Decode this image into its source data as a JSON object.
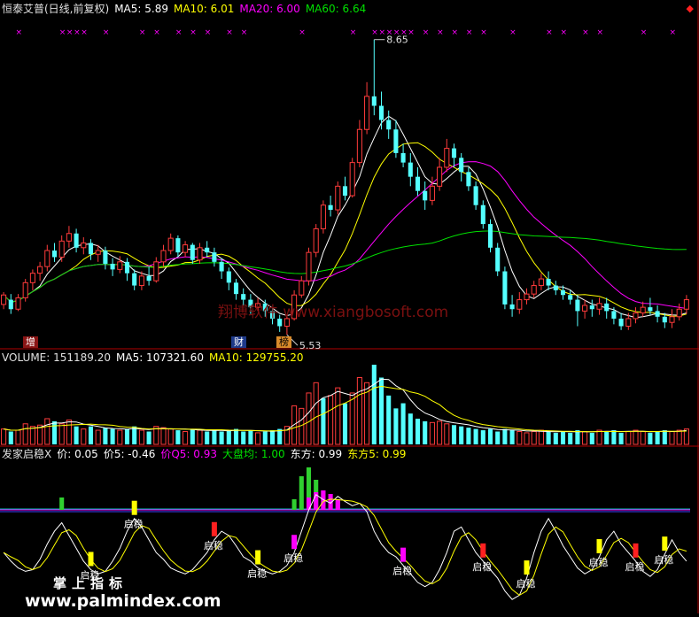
{
  "price_header": {
    "title": "恒泰艾普(日线,前复权)",
    "ma5": "MA5: 5.89",
    "ma10": "MA10: 6.01",
    "ma20": "MA20: 6.00",
    "ma60": "MA60: 6.64"
  },
  "volume_header": {
    "volume": "VOLUME: 151189.20",
    "ma5": "MA5: 107321.60",
    "ma10": "MA10: 129755.20"
  },
  "indicator_header": {
    "name": "发家启稳X",
    "jia": "价: 0.05",
    "jia5": "价5: -0.46",
    "jiaq5": "价Q5: 0.93",
    "dapan": "大盘均: 1.00",
    "dongfang": "东方: 0.99",
    "dongfang5": "东方5: 0.99"
  },
  "annotations": {
    "high": "8.65",
    "low": "5.53",
    "tag_zeng": "增",
    "tag_cai": "财",
    "tag_bang": "榜"
  },
  "signal_label": "启稳",
  "watermarks": {
    "center": "翔博软件 www.xiangbosoft.com",
    "zhang": "掌上指标",
    "site": "www.palmindex.com"
  },
  "colors": {
    "up": "#ff3b3b",
    "down": "#54ffff",
    "ma5": "#ffffff",
    "ma10": "#ffff00",
    "ma20": "#ff00ff",
    "ma60": "#00e000",
    "border": "#b00000"
  },
  "chart_data": {
    "type": "candlestick",
    "high": 8.65,
    "low": 5.53,
    "ylim": [
      5.4,
      8.9
    ],
    "candles": [
      [
        5.85,
        5.95,
        5.8,
        5.98
      ],
      [
        5.9,
        5.8,
        5.75,
        5.96
      ],
      [
        5.8,
        5.92,
        5.78,
        5.96
      ],
      [
        5.92,
        6.08,
        5.88,
        6.12
      ],
      [
        6.08,
        6.18,
        6.0,
        6.22
      ],
      [
        6.18,
        6.25,
        6.1,
        6.3
      ],
      [
        6.25,
        6.42,
        6.2,
        6.48
      ],
      [
        6.42,
        6.35,
        6.3,
        6.5
      ],
      [
        6.35,
        6.52,
        6.3,
        6.58
      ],
      [
        6.52,
        6.6,
        6.45,
        6.68
      ],
      [
        6.6,
        6.45,
        6.4,
        6.65
      ],
      [
        6.45,
        6.5,
        6.38,
        6.56
      ],
      [
        6.5,
        6.38,
        6.32,
        6.54
      ],
      [
        6.38,
        6.42,
        6.3,
        6.48
      ],
      [
        6.42,
        6.28,
        6.22,
        6.46
      ],
      [
        6.28,
        6.22,
        6.15,
        6.34
      ],
      [
        6.22,
        6.3,
        6.18,
        6.36
      ],
      [
        6.3,
        6.18,
        6.1,
        6.34
      ],
      [
        6.18,
        6.05,
        6.0,
        6.22
      ],
      [
        6.05,
        6.15,
        6.0,
        6.2
      ],
      [
        6.15,
        6.1,
        6.05,
        6.25
      ],
      [
        6.1,
        6.3,
        6.08,
        6.35
      ],
      [
        6.3,
        6.42,
        6.25,
        6.48
      ],
      [
        6.42,
        6.55,
        6.38,
        6.6
      ],
      [
        6.55,
        6.4,
        6.35,
        6.58
      ],
      [
        6.4,
        6.48,
        6.35,
        6.52
      ],
      [
        6.48,
        6.32,
        6.28,
        6.5
      ],
      [
        6.32,
        6.45,
        6.28,
        6.5
      ],
      [
        6.45,
        6.4,
        6.35,
        6.52
      ],
      [
        6.4,
        6.3,
        6.25,
        6.45
      ],
      [
        6.3,
        6.2,
        6.12,
        6.34
      ],
      [
        6.2,
        6.08,
        6.0,
        6.24
      ],
      [
        6.08,
        5.96,
        5.9,
        6.12
      ],
      [
        5.96,
        5.9,
        5.84,
        6.02
      ],
      [
        5.9,
        5.82,
        5.75,
        5.96
      ],
      [
        5.82,
        5.86,
        5.78,
        5.92
      ],
      [
        5.86,
        5.78,
        5.72,
        5.9
      ],
      [
        5.78,
        5.7,
        5.64,
        5.82
      ],
      [
        5.7,
        5.62,
        5.56,
        5.74
      ],
      [
        5.62,
        5.7,
        5.53,
        5.74
      ],
      [
        5.7,
        5.95,
        5.68,
        6.0
      ],
      [
        5.95,
        6.1,
        5.92,
        6.15
      ],
      [
        6.1,
        6.4,
        6.05,
        6.45
      ],
      [
        6.4,
        6.65,
        6.35,
        6.7
      ],
      [
        6.65,
        6.9,
        6.6,
        6.95
      ],
      [
        6.9,
        6.85,
        6.78,
        7.0
      ],
      [
        6.85,
        7.1,
        6.8,
        7.15
      ],
      [
        7.1,
        7.0,
        6.95,
        7.2
      ],
      [
        7.0,
        7.35,
        6.98,
        7.4
      ],
      [
        7.35,
        7.7,
        7.3,
        7.8
      ],
      [
        7.7,
        8.05,
        7.65,
        8.2
      ],
      [
        8.05,
        7.95,
        7.85,
        8.65
      ],
      [
        7.95,
        7.8,
        7.7,
        8.1
      ],
      [
        7.8,
        7.7,
        7.6,
        7.9
      ],
      [
        7.7,
        7.45,
        7.4,
        7.8
      ],
      [
        7.45,
        7.35,
        7.3,
        7.55
      ],
      [
        7.35,
        7.2,
        7.1,
        7.45
      ],
      [
        7.2,
        7.05,
        7.0,
        7.3
      ],
      [
        7.05,
        6.95,
        6.85,
        7.15
      ],
      [
        6.95,
        7.1,
        6.9,
        7.2
      ],
      [
        7.1,
        7.3,
        7.05,
        7.4
      ],
      [
        7.3,
        7.5,
        7.25,
        7.6
      ],
      [
        7.5,
        7.4,
        7.3,
        7.55
      ],
      [
        7.4,
        7.25,
        7.15,
        7.45
      ],
      [
        7.25,
        7.1,
        7.05,
        7.3
      ],
      [
        7.1,
        6.9,
        6.85,
        7.15
      ],
      [
        6.9,
        6.7,
        6.65,
        6.95
      ],
      [
        6.7,
        6.45,
        6.4,
        6.75
      ],
      [
        6.45,
        6.2,
        6.15,
        6.5
      ],
      [
        6.2,
        5.85,
        5.8,
        6.25
      ],
      [
        5.85,
        5.8,
        5.72,
        5.95
      ],
      [
        5.8,
        5.9,
        5.75,
        5.98
      ],
      [
        5.9,
        5.96,
        5.85,
        6.02
      ],
      [
        5.96,
        6.05,
        5.92,
        6.1
      ],
      [
        6.05,
        6.12,
        6.0,
        6.18
      ],
      [
        6.12,
        6.05,
        6.0,
        6.2
      ],
      [
        6.05,
        6.0,
        5.95,
        6.1
      ],
      [
        6.0,
        5.95,
        5.9,
        6.05
      ],
      [
        5.95,
        5.9,
        5.85,
        6.0
      ],
      [
        5.9,
        5.78,
        5.62,
        5.95
      ],
      [
        5.78,
        5.84,
        5.7,
        5.9
      ],
      [
        5.84,
        5.8,
        5.72,
        5.9
      ],
      [
        5.8,
        5.86,
        5.74,
        5.92
      ],
      [
        5.86,
        5.78,
        5.7,
        5.92
      ],
      [
        5.78,
        5.7,
        5.64,
        5.82
      ],
      [
        5.7,
        5.62,
        5.58,
        5.76
      ],
      [
        5.62,
        5.7,
        5.58,
        5.76
      ],
      [
        5.7,
        5.76,
        5.65,
        5.82
      ],
      [
        5.76,
        5.82,
        5.72,
        5.88
      ],
      [
        5.82,
        5.78,
        5.74,
        5.92
      ],
      [
        5.78,
        5.72,
        5.66,
        5.84
      ],
      [
        5.72,
        5.66,
        5.6,
        5.76
      ],
      [
        5.66,
        5.72,
        5.6,
        5.8
      ],
      [
        5.72,
        5.8,
        5.68,
        5.86
      ],
      [
        5.8,
        5.9,
        5.75,
        5.95
      ]
    ],
    "volume": [
      [
        0.6,
        1
      ],
      [
        0.5,
        0
      ],
      [
        0.55,
        1
      ],
      [
        0.8,
        1
      ],
      [
        0.7,
        1
      ],
      [
        0.75,
        1
      ],
      [
        1.0,
        1
      ],
      [
        0.9,
        0
      ],
      [
        0.8,
        1
      ],
      [
        0.95,
        1
      ],
      [
        0.7,
        0
      ],
      [
        0.6,
        1
      ],
      [
        0.7,
        0
      ],
      [
        0.55,
        1
      ],
      [
        0.65,
        0
      ],
      [
        0.6,
        0
      ],
      [
        0.55,
        1
      ],
      [
        0.6,
        0
      ],
      [
        0.7,
        0
      ],
      [
        0.55,
        1
      ],
      [
        0.5,
        0
      ],
      [
        0.7,
        1
      ],
      [
        0.65,
        1
      ],
      [
        0.6,
        1
      ],
      [
        0.55,
        0
      ],
      [
        0.5,
        1
      ],
      [
        0.6,
        0
      ],
      [
        0.55,
        1
      ],
      [
        0.5,
        0
      ],
      [
        0.55,
        0
      ],
      [
        0.5,
        0
      ],
      [
        0.55,
        0
      ],
      [
        0.6,
        0
      ],
      [
        0.5,
        0
      ],
      [
        0.55,
        0
      ],
      [
        0.45,
        1
      ],
      [
        0.5,
        0
      ],
      [
        0.55,
        0
      ],
      [
        0.6,
        0
      ],
      [
        0.7,
        1
      ],
      [
        1.5,
        1
      ],
      [
        1.4,
        1
      ],
      [
        2.0,
        1
      ],
      [
        2.4,
        1
      ],
      [
        1.8,
        0
      ],
      [
        1.9,
        1
      ],
      [
        2.2,
        1
      ],
      [
        1.6,
        0
      ],
      [
        2.0,
        1
      ],
      [
        2.6,
        1
      ],
      [
        2.4,
        1
      ],
      [
        3.1,
        0
      ],
      [
        2.6,
        0
      ],
      [
        1.9,
        0
      ],
      [
        1.4,
        0
      ],
      [
        1.6,
        0
      ],
      [
        1.2,
        0
      ],
      [
        1.0,
        0
      ],
      [
        0.9,
        0
      ],
      [
        0.85,
        1
      ],
      [
        0.9,
        1
      ],
      [
        0.8,
        1
      ],
      [
        0.75,
        0
      ],
      [
        0.7,
        0
      ],
      [
        0.65,
        0
      ],
      [
        0.6,
        0
      ],
      [
        0.55,
        0
      ],
      [
        0.6,
        0
      ],
      [
        0.5,
        0
      ],
      [
        0.6,
        0
      ],
      [
        0.55,
        0
      ],
      [
        0.5,
        1
      ],
      [
        0.45,
        1
      ],
      [
        0.5,
        1
      ],
      [
        0.55,
        1
      ],
      [
        0.5,
        0
      ],
      [
        0.45,
        0
      ],
      [
        0.5,
        0
      ],
      [
        0.45,
        0
      ],
      [
        0.55,
        0
      ],
      [
        0.5,
        1
      ],
      [
        0.45,
        0
      ],
      [
        0.55,
        1
      ],
      [
        0.5,
        0
      ],
      [
        0.55,
        0
      ],
      [
        0.45,
        0
      ],
      [
        0.5,
        1
      ],
      [
        0.55,
        1
      ],
      [
        0.5,
        1
      ],
      [
        0.45,
        0
      ],
      [
        0.5,
        0
      ],
      [
        0.55,
        0
      ],
      [
        0.5,
        1
      ],
      [
        0.55,
        1
      ],
      [
        0.6,
        1
      ]
    ],
    "oscillator": [
      0.3,
      0.2,
      0.12,
      0.08,
      0.1,
      0.22,
      0.4,
      0.55,
      0.65,
      0.5,
      0.35,
      0.2,
      0.1,
      0.05,
      0.08,
      0.2,
      0.35,
      0.55,
      0.7,
      0.6,
      0.45,
      0.3,
      0.22,
      0.12,
      0.08,
      0.05,
      0.1,
      0.2,
      0.3,
      0.45,
      0.55,
      0.5,
      0.38,
      0.25,
      0.2,
      0.12,
      0.08,
      0.05,
      0.08,
      0.15,
      0.3,
      0.55,
      0.8,
      0.98,
      0.92,
      0.88,
      0.96,
      0.9,
      0.85,
      0.88,
      0.78,
      0.55,
      0.4,
      0.3,
      0.25,
      0.15,
      0.05,
      -0.05,
      -0.1,
      -0.05,
      0.1,
      0.3,
      0.55,
      0.6,
      0.45,
      0.3,
      0.2,
      0.1,
      0.0,
      -0.15,
      -0.25,
      -0.2,
      0.0,
      0.3,
      0.55,
      0.7,
      0.55,
      0.38,
      0.25,
      0.12,
      0.05,
      0.1,
      0.25,
      0.45,
      0.55,
      0.4,
      0.3,
      0.2,
      0.08,
      0.02,
      0.1,
      0.28,
      0.45,
      0.3,
      0.2
    ],
    "signals": [
      12,
      18,
      29,
      35,
      40,
      55,
      66,
      72,
      82,
      87,
      91
    ]
  }
}
